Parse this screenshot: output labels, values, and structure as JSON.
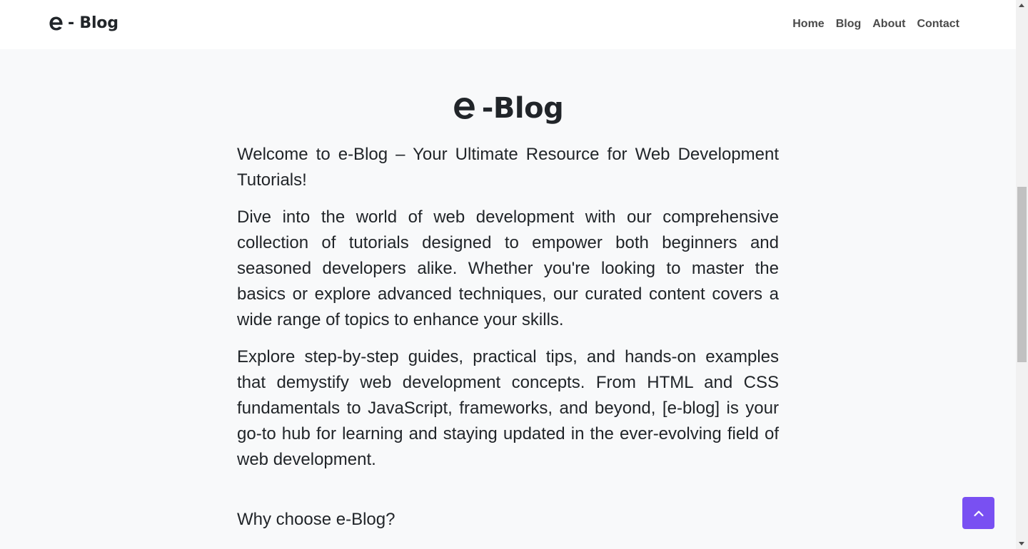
{
  "navbar": {
    "brand": "- Blog",
    "links": [
      "Home",
      "Blog",
      "About",
      "Contact"
    ]
  },
  "hero": {
    "title": "-Blog"
  },
  "content": {
    "welcome": "Welcome to e-Blog – Your Ultimate Resource for Web Development Tutorials!",
    "paragraph1": "Dive into the world of web development with our comprehensive collection of tutorials designed to empower both beginners and seasoned developers alike. Whether you're looking to master the basics or explore advanced techniques, our curated content covers a wide range of topics to enhance your skills.",
    "paragraph2": "Explore step-by-step guides, practical tips, and hands-on examples that demystify web development concepts. From HTML and CSS fundamentals to JavaScript, frameworks, and beyond, [e-blog] is your go-to hub for learning and staying updated in the ever-evolving field of web development.",
    "why_heading": "Why choose e-Blog?"
  },
  "icons": {
    "brand_logo": "e-logo-icon",
    "back_to_top": "chevron-up-icon"
  },
  "colors": {
    "accent": "#7950f2",
    "background": "#f8f9fa",
    "navbar": "#ffffff",
    "text": "#212529"
  }
}
